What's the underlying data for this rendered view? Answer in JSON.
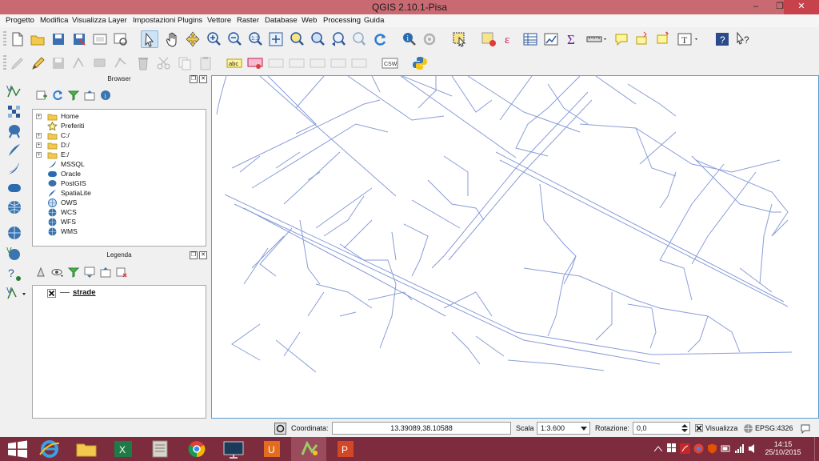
{
  "window": {
    "title": "QGIS 2.10.1-Pisa",
    "controls": [
      "minimize",
      "maximize",
      "close"
    ]
  },
  "menubar": {
    "items": [
      "Progetto",
      "Modifica",
      "Visualizza",
      "Layer",
      "Impostazioni",
      "Plugins",
      "Vettore",
      "Raster",
      "Database",
      "Web",
      "Processing",
      "Guida"
    ]
  },
  "toolbar_top": {
    "icons": [
      "new-project-icon",
      "open-project-icon",
      "save-project-icon",
      "save-as-icon",
      "print-composer-icon",
      "composer-manager-icon",
      "pan-select-icon",
      "pan-hand-icon",
      "pan-to-selection-icon",
      "zoom-in-icon",
      "zoom-out-icon",
      "zoom-native-icon",
      "zoom-full-icon",
      "zoom-selection-icon",
      "zoom-layer-icon",
      "zoom-last-icon",
      "zoom-next-icon",
      "refresh-icon",
      "identify-icon",
      "action-icon",
      "select-features-icon",
      "deselect-icon",
      "expression-icon",
      "attribute-table-icon",
      "statistics-icon",
      "sum-icon",
      "measure-icon",
      "annotation-icon",
      "move-annotation-icon",
      "label-icon",
      "text-annotation-icon",
      "help-icon",
      "whats-this-icon"
    ]
  },
  "toolbar_second": {
    "icons": [
      "current-edits-icon",
      "toggle-editing-icon",
      "save-edits-icon",
      "add-feature-icon",
      "move-feature-icon",
      "node-tool-icon",
      "delete-selected-icon",
      "cut-features-icon",
      "copy-features-icon",
      "paste-features-icon",
      "label-abc-icon",
      "label-pin-icon",
      "label-highlight-icon",
      "label-move-icon",
      "label-rotate-icon",
      "label-properties-icon",
      "label-show-icon",
      "csw-icon",
      "python-console-icon"
    ],
    "label_abc": "abc",
    "csw": "CSW"
  },
  "left_toolbar": {
    "icons": [
      "add-vector-layer-icon",
      "add-raster-layer-icon",
      "add-postgis-layer-icon",
      "add-spatialite-layer-icon",
      "add-mssql-layer-icon",
      "add-oracle-layer-icon",
      "add-wms-layer-icon",
      "add-wcs-layer-icon",
      "add-wfs-layer-icon",
      "add-delimited-text-icon",
      "new-shapefile-icon"
    ]
  },
  "browser": {
    "title": "Browser",
    "items": [
      {
        "label": "Home",
        "icon": "folder-icon",
        "expandable": true
      },
      {
        "label": "Preferiti",
        "icon": "star-icon",
        "expandable": false
      },
      {
        "label": "C:/",
        "icon": "folder-icon",
        "expandable": true
      },
      {
        "label": "D:/",
        "icon": "folder-icon",
        "expandable": true
      },
      {
        "label": "E:/",
        "icon": "folder-icon",
        "expandable": true
      },
      {
        "label": "MSSQL",
        "icon": "mssql-icon",
        "expandable": false
      },
      {
        "label": "Oracle",
        "icon": "oracle-icon",
        "expandable": false
      },
      {
        "label": "PostGIS",
        "icon": "postgis-icon",
        "expandable": false
      },
      {
        "label": "SpatiaLite",
        "icon": "spatialite-icon",
        "expandable": false
      },
      {
        "label": "OWS",
        "icon": "globe-icon",
        "expandable": false
      },
      {
        "label": "WCS",
        "icon": "globe-icon",
        "expandable": false
      },
      {
        "label": "WFS",
        "icon": "globe-icon",
        "expandable": false
      },
      {
        "label": "WMS",
        "icon": "globe-icon",
        "expandable": false
      }
    ]
  },
  "legend": {
    "title": "Legenda",
    "layers": [
      {
        "label": "strade",
        "visible": true
      }
    ]
  },
  "status": {
    "coord_label": "Coordinata:",
    "coord_value": "13.39089,38.10588",
    "scale_label": "Scala",
    "scale_value": "1:3.600",
    "rotation_label": "Rotazione:",
    "rotation_value": "0,0",
    "render_label": "Visualizza",
    "render_checked": true,
    "crs": "EPSG:4326"
  },
  "taskbar": {
    "apps": [
      "start-icon",
      "internet-explorer-icon",
      "file-explorer-icon",
      "excel-icon",
      "notepad-icon",
      "chrome-icon",
      "monitor-icon",
      "onenote-icon",
      "qgis-icon",
      "powerpoint-icon"
    ],
    "active_app": "qgis-icon",
    "time": "14:15",
    "date": "25/10/2015"
  },
  "colors": {
    "titlebar": "#c96a72",
    "taskbar": "#7c2c3c",
    "road_lines": "#8a9ed8",
    "map_border": "#5b9bd5"
  }
}
